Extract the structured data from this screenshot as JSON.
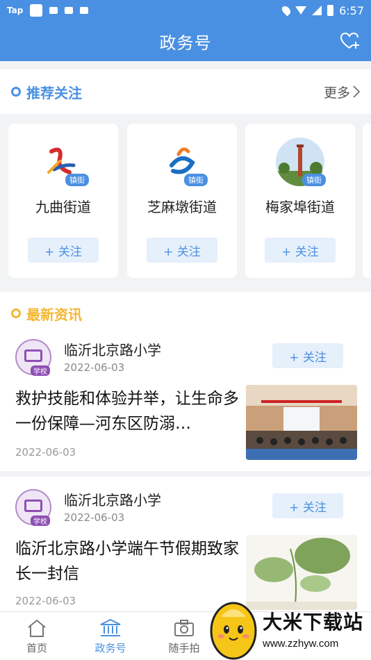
{
  "status_bar": {
    "carrier": "Tap",
    "time": "6:57"
  },
  "header": {
    "title": "政务号",
    "icons": [
      "heart-plus-icon"
    ]
  },
  "recommended": {
    "title": "推荐关注",
    "more_label": "更多",
    "cards": [
      {
        "name": "九曲街道",
        "badge": "镇街",
        "follow_label": "+ 关注"
      },
      {
        "name": "芝麻墩街道",
        "badge": "镇街",
        "follow_label": "+ 关注"
      },
      {
        "name": "梅家埠街道",
        "badge": "镇街",
        "follow_label": "+ 关注"
      }
    ]
  },
  "news": {
    "title": "最新资讯",
    "items": [
      {
        "source": "临沂北京路小学",
        "source_tag": "学校",
        "source_date": "2022-06-03",
        "follow_label": "+ 关注",
        "headline": "救护技能和体验并举，让生命多一份保障—河东区防溺…",
        "date": "2022-06-03"
      },
      {
        "source": "临沂北京路小学",
        "source_tag": "学校",
        "source_date": "2022-06-03",
        "follow_label": "+ 关注",
        "headline": "临沂北京路小学端午节假期致家长一封信",
        "date": "2022-06-03"
      }
    ]
  },
  "tab_bar": {
    "tabs": [
      {
        "label": "首页",
        "icon": "home-icon",
        "active": false
      },
      {
        "label": "政务号",
        "icon": "government-building-icon",
        "active": true
      },
      {
        "label": "随手拍",
        "icon": "camera-icon",
        "active": false
      }
    ]
  },
  "watermark": {
    "brand": "大米下载站",
    "url": "www.zzhyw.com"
  },
  "colors": {
    "primary": "#4a90e2",
    "accent_dot": "#f5b731",
    "follow_bg": "#e6f0fb",
    "school_purple": "#8e4fb5"
  }
}
